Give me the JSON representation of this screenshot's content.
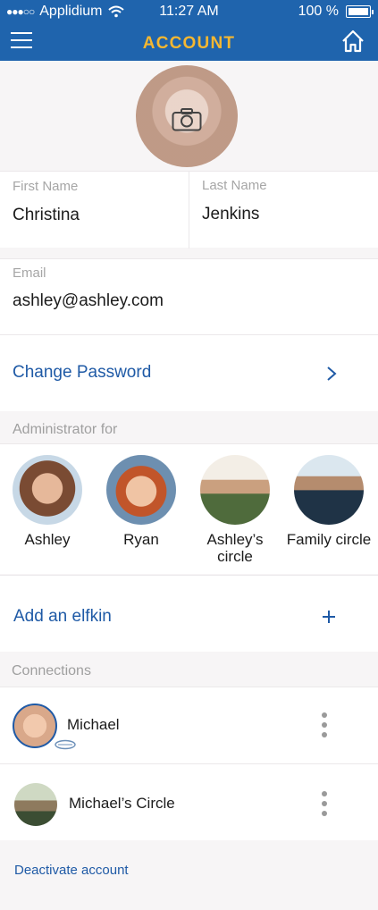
{
  "status_bar": {
    "carrier": "Applidium",
    "time": "11:27 AM",
    "battery": "100 %"
  },
  "header": {
    "title": "ACCOUNT"
  },
  "profile": {
    "first_name_label": "First Name",
    "first_name": "Christina",
    "last_name_label": "Last Name",
    "last_name": "Jenkins",
    "email_label": "Email",
    "email": "ashley@ashley.com",
    "change_password": "Change Password"
  },
  "administrator": {
    "section_label": "Administrator for",
    "items": [
      {
        "name": "Ashley"
      },
      {
        "name": "Ryan"
      },
      {
        "name": "Ashley’s circle"
      },
      {
        "name": "Family circle"
      }
    ],
    "add_label": "Add an elfkin"
  },
  "connections": {
    "section_label": "Connections",
    "items": [
      {
        "name": "Michael"
      },
      {
        "name": "Michael’s Circle"
      }
    ]
  },
  "footer": {
    "deactivate": "Deactivate account"
  },
  "colors": {
    "header_bg": "#1f64ad",
    "title": "#f5b731",
    "link": "#1f5aa6"
  }
}
